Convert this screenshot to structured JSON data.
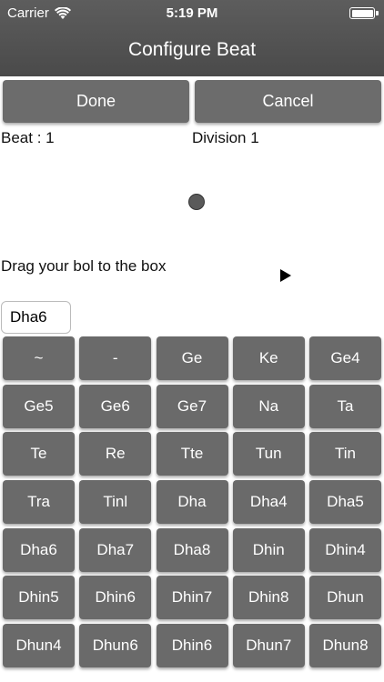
{
  "status_bar": {
    "carrier": "Carrier",
    "time": "5:19 PM"
  },
  "nav": {
    "title": "Configure Beat"
  },
  "actions": {
    "done_label": "Done",
    "cancel_label": "Cancel"
  },
  "beat": {
    "beat_label": "Beat : 1",
    "division_label": "Division 1"
  },
  "drag": {
    "instruction": "Drag your bol to the box",
    "box_value": "Dha6"
  },
  "bols": [
    "~",
    "-",
    "Ge",
    "Ke",
    "Ge4",
    "Ge5",
    "Ge6",
    "Ge7",
    "Na",
    "Ta",
    "Te",
    "Re",
    "Tte",
    "Tun",
    "Tin",
    "Tra",
    "Tinl",
    "Dha",
    "Dha4",
    "Dha5",
    "Dha6",
    "Dha7",
    "Dha8",
    "Dhin",
    "Dhin4",
    "Dhin5",
    "Dhin6",
    "Dhin7",
    "Dhin8",
    "Dhun",
    "Dhun4",
    "Dhun6",
    "Dhin6",
    "Dhun7",
    "Dhun8"
  ],
  "icons": {
    "wifi": "wifi-icon",
    "battery": "battery-icon",
    "play": "play-icon",
    "dot": "record-dot-icon"
  }
}
